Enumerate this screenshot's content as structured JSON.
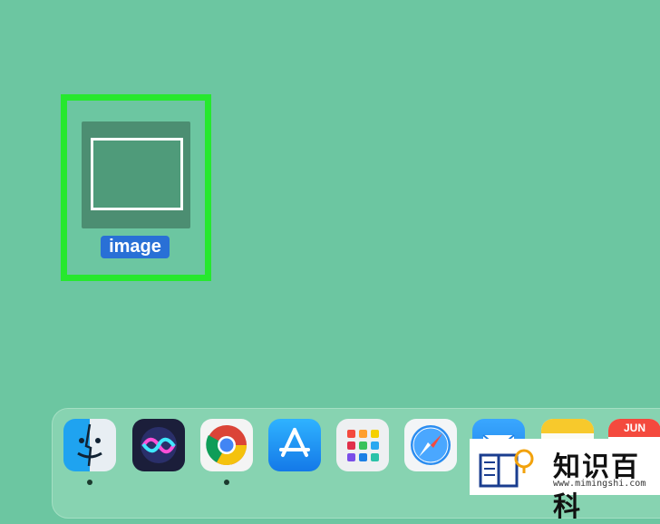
{
  "desktop": {
    "file": {
      "label": "image"
    }
  },
  "dock": {
    "apps": [
      {
        "name": "Finder",
        "running": true
      },
      {
        "name": "Siri",
        "running": false
      },
      {
        "name": "Google Chrome",
        "running": true
      },
      {
        "name": "App Store",
        "running": false
      },
      {
        "name": "Launchpad",
        "running": false
      },
      {
        "name": "Safari",
        "running": false
      },
      {
        "name": "Mail",
        "running": false
      },
      {
        "name": "Notes",
        "running": false
      },
      {
        "name": "Calendar",
        "running": false
      }
    ],
    "calendar_month": "JUN"
  },
  "watermark": {
    "title": "知识百科",
    "url": "www.mimingshi.com"
  },
  "colors": {
    "desktop_bg": "#6cc6a1",
    "highlight": "#26e82e",
    "selection_label": "#2970d6"
  }
}
